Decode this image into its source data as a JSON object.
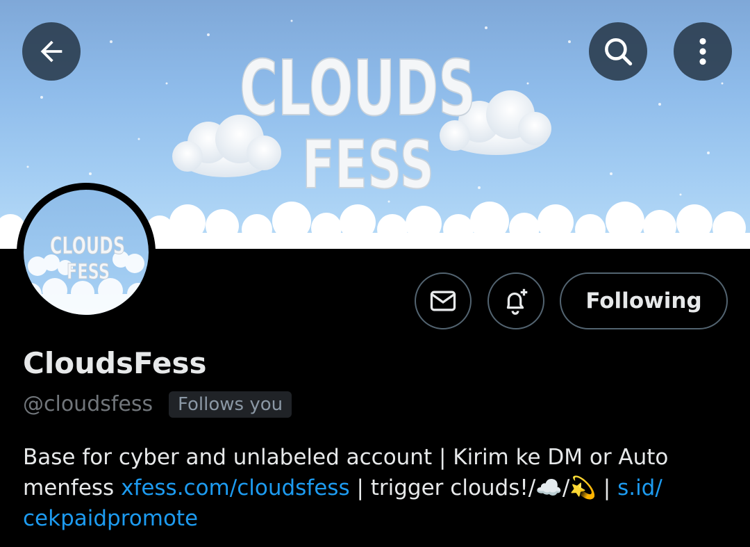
{
  "header": {
    "banner_text_line1": "CLOUDS",
    "banner_text_line2": "FESS",
    "back_icon": "arrow-left-icon",
    "search_icon": "search-icon",
    "more_icon": "more-vertical-icon"
  },
  "avatar": {
    "text_line1": "CLOUDS",
    "text_line2": "FESS"
  },
  "actions": {
    "message_icon": "mail-icon",
    "notify_icon": "bell-plus-icon",
    "following_label": "Following"
  },
  "profile": {
    "display_name": "CloudsFess",
    "handle": "@cloudsfess",
    "follows_you": "Follows you"
  },
  "bio": {
    "text1": "Base for cyber and unlabeled account | Kirim ke DM or Auto menfess ",
    "link1": "xfess.com/cloudsfess",
    "text2": " | trigger clouds!/☁️/💫 |  ",
    "link2": "s.id/​cekpaidpromote"
  },
  "colors": {
    "link": "#1d9bf0",
    "background": "#000000",
    "secondary_text": "#71767b",
    "banner_sky": "#8ebbea"
  }
}
